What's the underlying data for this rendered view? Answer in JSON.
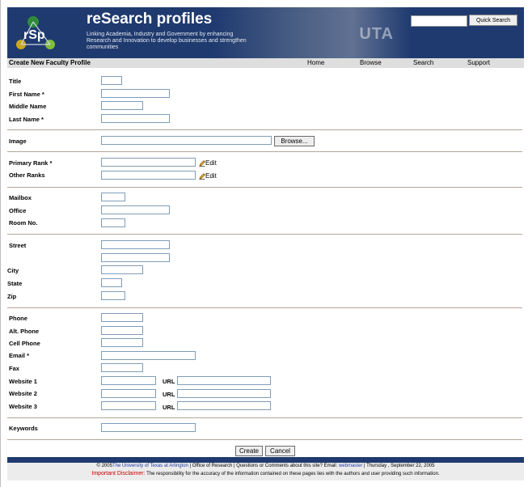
{
  "header": {
    "brand": "reSearch profiles",
    "tagline": "Linking Academia, Industry and Government by enhancing Research and Innovation to develop businesses and  strengthen communities",
    "logo_text": "rSp",
    "photo_text": "UTA",
    "quick_search_label": "Quick Search",
    "quick_search_value": ""
  },
  "navbar": {
    "page_title": "Create New Faculty Profile",
    "items": [
      "Home",
      "Browse",
      "Search",
      "Support"
    ]
  },
  "form": {
    "name": {
      "title": "Title",
      "first_name": "First Name *",
      "middle_name": "Middle Name",
      "last_name": "Last Name *"
    },
    "image": {
      "label": "Image",
      "browse": "Browse..."
    },
    "ranks": {
      "primary": "Primary Rank *",
      "other": "Other Ranks",
      "edit": "Edit"
    },
    "office": {
      "mailbox": "Mailbox",
      "office": "Office",
      "room": "Room No."
    },
    "address": {
      "street": "Street",
      "city": "City",
      "state": "State",
      "zip": "Zip"
    },
    "contact": {
      "phone": "Phone",
      "alt_phone": "Alt. Phone",
      "cell_phone": "Cell Phone",
      "email": "Email *",
      "fax": "Fax",
      "website1": "Website 1",
      "website2": "Website 2",
      "website3": "Website 3",
      "url": "URL"
    },
    "keywords": "Keywords",
    "create": "Create",
    "cancel": "Cancel"
  },
  "footer": {
    "copyright": "© 2005",
    "university": "The University of Texas at Arlington",
    "middle": " | Office of Research | Questions or Comments about this site? Email: ",
    "webmaster": "webmaster",
    "date": " | Thursday , September 22, 2005",
    "disclaimer_title": "Important Disclaimer:",
    "disclaimer_text": " The responsibility for the accuracy of the information contained on these pages lies with the authors and user providing such information."
  },
  "colors": {
    "header_bg": "#1f3a6f",
    "link": "#1f3a9f",
    "disclaimer": "#cc0000"
  }
}
